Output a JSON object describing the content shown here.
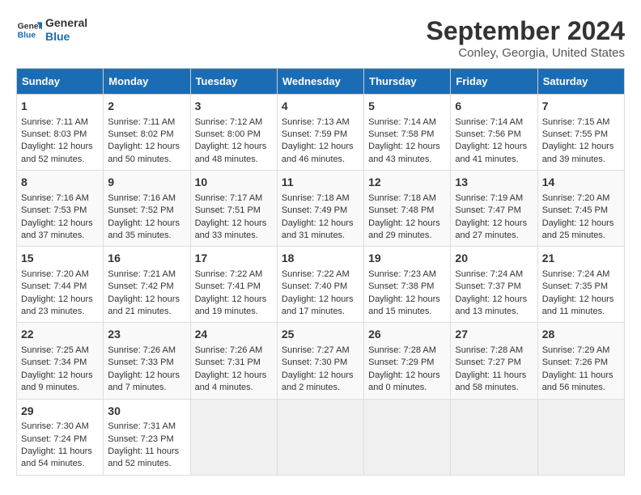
{
  "logo": {
    "line1": "General",
    "line2": "Blue"
  },
  "title": "September 2024",
  "location": "Conley, Georgia, United States",
  "weekdays": [
    "Sunday",
    "Monday",
    "Tuesday",
    "Wednesday",
    "Thursday",
    "Friday",
    "Saturday"
  ],
  "weeks": [
    [
      {
        "day": "1",
        "sunrise": "Sunrise: 7:11 AM",
        "sunset": "Sunset: 8:03 PM",
        "daylight": "Daylight: 12 hours and 52 minutes."
      },
      {
        "day": "2",
        "sunrise": "Sunrise: 7:11 AM",
        "sunset": "Sunset: 8:02 PM",
        "daylight": "Daylight: 12 hours and 50 minutes."
      },
      {
        "day": "3",
        "sunrise": "Sunrise: 7:12 AM",
        "sunset": "Sunset: 8:00 PM",
        "daylight": "Daylight: 12 hours and 48 minutes."
      },
      {
        "day": "4",
        "sunrise": "Sunrise: 7:13 AM",
        "sunset": "Sunset: 7:59 PM",
        "daylight": "Daylight: 12 hours and 46 minutes."
      },
      {
        "day": "5",
        "sunrise": "Sunrise: 7:14 AM",
        "sunset": "Sunset: 7:58 PM",
        "daylight": "Daylight: 12 hours and 43 minutes."
      },
      {
        "day": "6",
        "sunrise": "Sunrise: 7:14 AM",
        "sunset": "Sunset: 7:56 PM",
        "daylight": "Daylight: 12 hours and 41 minutes."
      },
      {
        "day": "7",
        "sunrise": "Sunrise: 7:15 AM",
        "sunset": "Sunset: 7:55 PM",
        "daylight": "Daylight: 12 hours and 39 minutes."
      }
    ],
    [
      {
        "day": "8",
        "sunrise": "Sunrise: 7:16 AM",
        "sunset": "Sunset: 7:53 PM",
        "daylight": "Daylight: 12 hours and 37 minutes."
      },
      {
        "day": "9",
        "sunrise": "Sunrise: 7:16 AM",
        "sunset": "Sunset: 7:52 PM",
        "daylight": "Daylight: 12 hours and 35 minutes."
      },
      {
        "day": "10",
        "sunrise": "Sunrise: 7:17 AM",
        "sunset": "Sunset: 7:51 PM",
        "daylight": "Daylight: 12 hours and 33 minutes."
      },
      {
        "day": "11",
        "sunrise": "Sunrise: 7:18 AM",
        "sunset": "Sunset: 7:49 PM",
        "daylight": "Daylight: 12 hours and 31 minutes."
      },
      {
        "day": "12",
        "sunrise": "Sunrise: 7:18 AM",
        "sunset": "Sunset: 7:48 PM",
        "daylight": "Daylight: 12 hours and 29 minutes."
      },
      {
        "day": "13",
        "sunrise": "Sunrise: 7:19 AM",
        "sunset": "Sunset: 7:47 PM",
        "daylight": "Daylight: 12 hours and 27 minutes."
      },
      {
        "day": "14",
        "sunrise": "Sunrise: 7:20 AM",
        "sunset": "Sunset: 7:45 PM",
        "daylight": "Daylight: 12 hours and 25 minutes."
      }
    ],
    [
      {
        "day": "15",
        "sunrise": "Sunrise: 7:20 AM",
        "sunset": "Sunset: 7:44 PM",
        "daylight": "Daylight: 12 hours and 23 minutes."
      },
      {
        "day": "16",
        "sunrise": "Sunrise: 7:21 AM",
        "sunset": "Sunset: 7:42 PM",
        "daylight": "Daylight: 12 hours and 21 minutes."
      },
      {
        "day": "17",
        "sunrise": "Sunrise: 7:22 AM",
        "sunset": "Sunset: 7:41 PM",
        "daylight": "Daylight: 12 hours and 19 minutes."
      },
      {
        "day": "18",
        "sunrise": "Sunrise: 7:22 AM",
        "sunset": "Sunset: 7:40 PM",
        "daylight": "Daylight: 12 hours and 17 minutes."
      },
      {
        "day": "19",
        "sunrise": "Sunrise: 7:23 AM",
        "sunset": "Sunset: 7:38 PM",
        "daylight": "Daylight: 12 hours and 15 minutes."
      },
      {
        "day": "20",
        "sunrise": "Sunrise: 7:24 AM",
        "sunset": "Sunset: 7:37 PM",
        "daylight": "Daylight: 12 hours and 13 minutes."
      },
      {
        "day": "21",
        "sunrise": "Sunrise: 7:24 AM",
        "sunset": "Sunset: 7:35 PM",
        "daylight": "Daylight: 12 hours and 11 minutes."
      }
    ],
    [
      {
        "day": "22",
        "sunrise": "Sunrise: 7:25 AM",
        "sunset": "Sunset: 7:34 PM",
        "daylight": "Daylight: 12 hours and 9 minutes."
      },
      {
        "day": "23",
        "sunrise": "Sunrise: 7:26 AM",
        "sunset": "Sunset: 7:33 PM",
        "daylight": "Daylight: 12 hours and 7 minutes."
      },
      {
        "day": "24",
        "sunrise": "Sunrise: 7:26 AM",
        "sunset": "Sunset: 7:31 PM",
        "daylight": "Daylight: 12 hours and 4 minutes."
      },
      {
        "day": "25",
        "sunrise": "Sunrise: 7:27 AM",
        "sunset": "Sunset: 7:30 PM",
        "daylight": "Daylight: 12 hours and 2 minutes."
      },
      {
        "day": "26",
        "sunrise": "Sunrise: 7:28 AM",
        "sunset": "Sunset: 7:29 PM",
        "daylight": "Daylight: 12 hours and 0 minutes."
      },
      {
        "day": "27",
        "sunrise": "Sunrise: 7:28 AM",
        "sunset": "Sunset: 7:27 PM",
        "daylight": "Daylight: 11 hours and 58 minutes."
      },
      {
        "day": "28",
        "sunrise": "Sunrise: 7:29 AM",
        "sunset": "Sunset: 7:26 PM",
        "daylight": "Daylight: 11 hours and 56 minutes."
      }
    ],
    [
      {
        "day": "29",
        "sunrise": "Sunrise: 7:30 AM",
        "sunset": "Sunset: 7:24 PM",
        "daylight": "Daylight: 11 hours and 54 minutes."
      },
      {
        "day": "30",
        "sunrise": "Sunrise: 7:31 AM",
        "sunset": "Sunset: 7:23 PM",
        "daylight": "Daylight: 11 hours and 52 minutes."
      },
      null,
      null,
      null,
      null,
      null
    ]
  ]
}
